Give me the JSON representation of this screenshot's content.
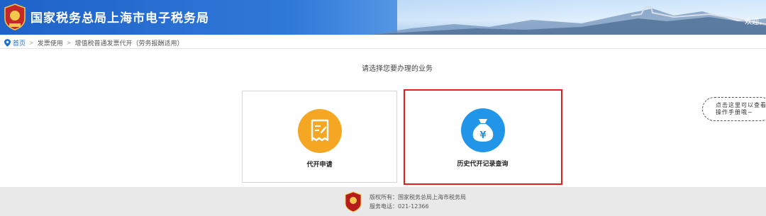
{
  "header": {
    "title": "国家税务总局上海市电子税务局",
    "welcome": "欢迎，",
    "logo_icon": "tax-emblem-icon"
  },
  "breadcrumb": {
    "home": "首页",
    "level1": "发票使用",
    "level2": "增值税普通发票代开（劳务报酬适用）"
  },
  "prompt": "请选择您要办理的业务",
  "cards": [
    {
      "label": "代开申请",
      "icon": "invoice-application-icon",
      "color": "#f5a623"
    },
    {
      "label": "历史代开记录查询",
      "icon": "money-bag-yen-icon",
      "color": "#2196e8"
    }
  ],
  "help": {
    "line1": "点击这里可以查看",
    "line2": "操作手册哦~"
  },
  "footer": {
    "copyright": "版权所有：国家税务总局上海市税务局",
    "phone": "服务电话：021-12366"
  },
  "colors": {
    "highlight": "#e0201e",
    "link": "#1e6fd0"
  }
}
